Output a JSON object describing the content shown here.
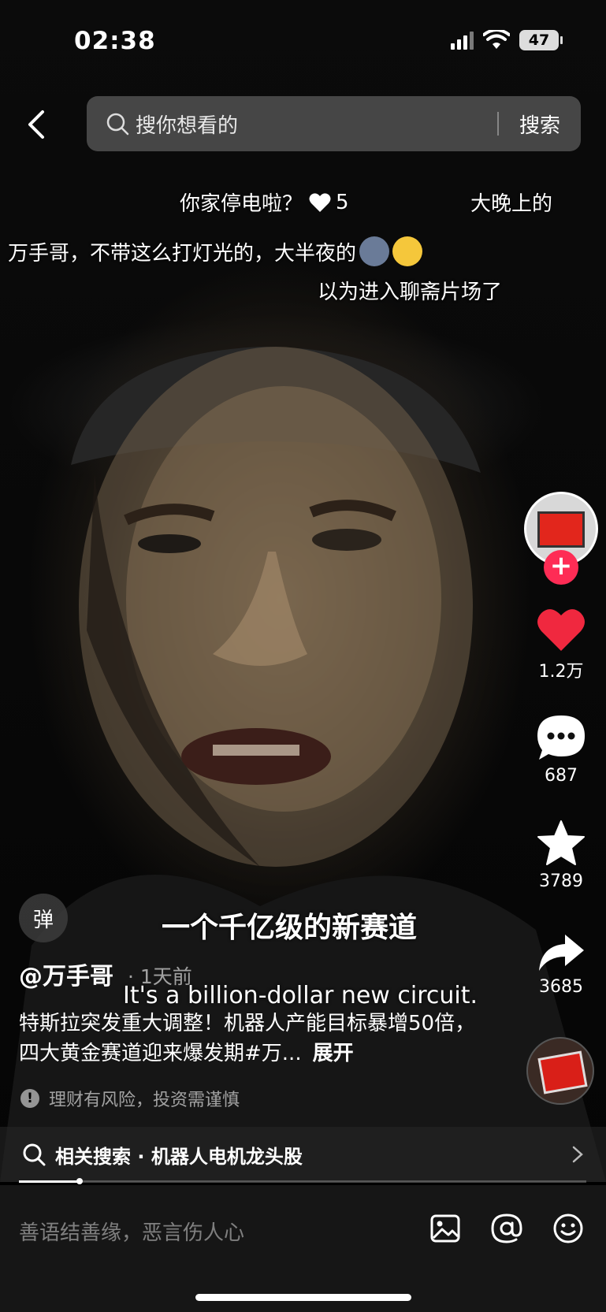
{
  "status_bar": {
    "time": "02:38",
    "battery": "47"
  },
  "top_bar": {
    "search_placeholder": "搜你想看的",
    "search_button": "搜索"
  },
  "danmaku": [
    {
      "text": "你家停电啦？",
      "likes": "5"
    },
    {
      "text": "大晚上的"
    },
    {
      "text": "万手哥，不带这么打灯光的，大半夜的"
    },
    {
      "text": "以为进入聊斋片场了"
    }
  ],
  "right_rail": {
    "like_count": "1.2万",
    "comment_count": "687",
    "favorite_count": "3789",
    "share_count": "3685"
  },
  "video": {
    "danmu_toggle_label": "弹",
    "subtitle_cn": "一个千亿级的新赛道",
    "subtitle_en": "It's a billion-dollar new circuit.",
    "author": "@万手哥",
    "time_ago": "· 1天前",
    "description": "特斯拉突发重大调整！机器人产能目标暴增50倍，四大黄金赛道迎来爆发期#万...",
    "expand_label": "展开",
    "risk_notice": "理财有风险，投资需谨慎",
    "progress": 0.107
  },
  "related_search": {
    "text": "相关搜索 · 机器人电机龙头股"
  },
  "comment_bar": {
    "placeholder": "善语结善缘，恶言伤人心"
  },
  "colors": {
    "accent_red": "#fe2c55",
    "like_red": "#f0283f"
  }
}
